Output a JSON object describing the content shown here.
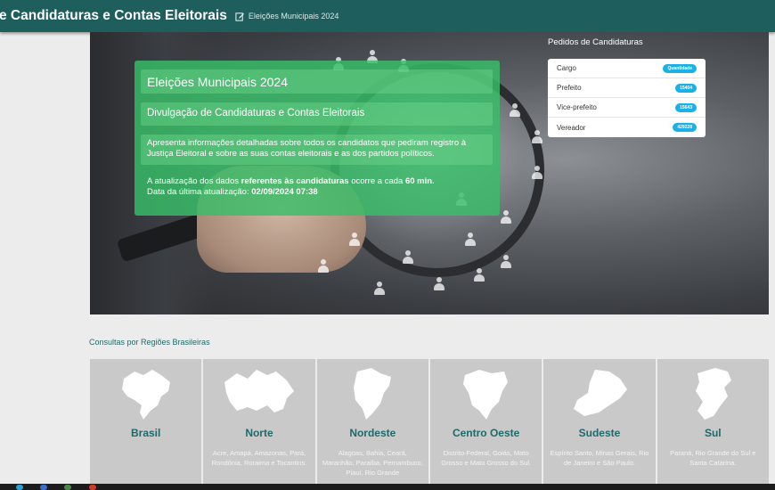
{
  "header": {
    "title": "e Candidaturas e Contas Eleitorais",
    "subtitle": "Eleições Municipais 2024"
  },
  "hero": {
    "title": "Eleições Municipais 2024",
    "subtitle": "Divulgação de Candidaturas e Contas Eleitorais",
    "description": "Apresenta informações detalhadas sobre todos os candidatos que pediram registro à Justiça Eleitoral e sobre as suas contas eleitorais e as dos partidos políticos.",
    "update_prefix": "A atualização dos dados ",
    "update_bold": "referentes às candidaturas",
    "update_mid": " ocorre a cada ",
    "update_interval": "60 min.",
    "last_update_label": "Data da última atualização: ",
    "last_update_value": "02/09/2024 07:38"
  },
  "pedidos": {
    "title": "Pedidos de Candidaturas",
    "rows": [
      {
        "label": "Cargo",
        "value": "Quantidade"
      },
      {
        "label": "Prefeito",
        "value": "15404"
      },
      {
        "label": "Vice-prefeito",
        "value": "15643"
      },
      {
        "label": "Vereador",
        "value": "429228"
      }
    ]
  },
  "regions": {
    "section_label": "Consultas por Regiões Brasileiras",
    "items": [
      {
        "name": "Brasil",
        "desc": ""
      },
      {
        "name": "Norte",
        "desc": "Acre, Amapá, Amazonas, Pará, Rondônia, Roraima e Tocantins."
      },
      {
        "name": "Nordeste",
        "desc": "Alagoas, Bahia, Ceará, Maranhão, Paraíba, Pernambuco, Piauí, Rio Grande"
      },
      {
        "name": "Centro Oeste",
        "desc": "Distrito-Federal, Goiás, Mato Grosso e Mato Grosso do Sul."
      },
      {
        "name": "Sudeste",
        "desc": "Espírito Santo, Minas Gerais, Rio de Janeiro e São Paulo."
      },
      {
        "name": "Sul",
        "desc": "Paraná, Rio Grande do Sul e Santa Catarina."
      }
    ]
  }
}
